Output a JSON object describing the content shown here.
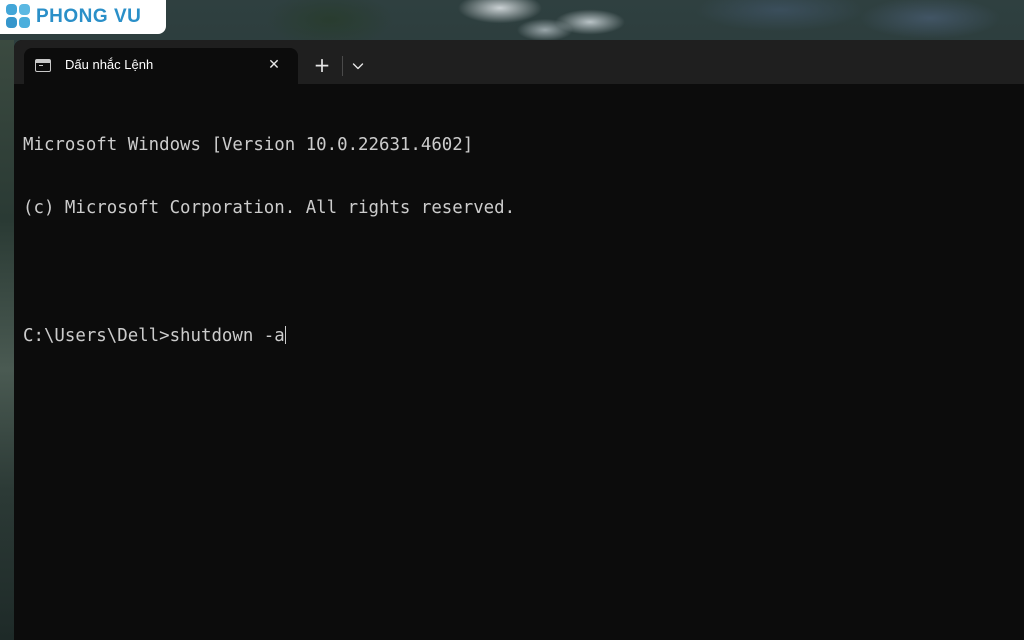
{
  "watermark": {
    "brand": "PHONG VU"
  },
  "window": {
    "tab": {
      "title": "Dấu nhắc Lệnh",
      "icon": "terminal-icon",
      "close_glyph": "✕"
    },
    "new_tab_glyph": "+",
    "dropdown_icon": "chevron-down-icon"
  },
  "console": {
    "lines": [
      "Microsoft Windows [Version 10.0.22631.4602]",
      "(c) Microsoft Corporation. All rights reserved.",
      "",
      "C:\\Users\\Dell>shutdown -a"
    ]
  },
  "colors": {
    "console_background": "#0c0c0c",
    "console_text": "#cccccc",
    "titlebar": "#1f1f1f",
    "brand_blue": "#2a8fc8"
  }
}
